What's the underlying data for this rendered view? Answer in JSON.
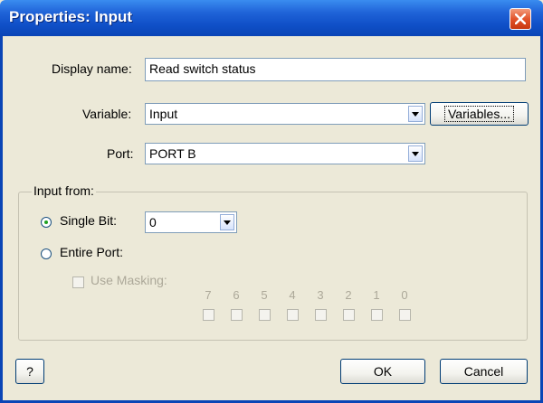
{
  "window": {
    "title": "Properties: Input"
  },
  "form": {
    "display_name_label": "Display name:",
    "display_name_value": "Read switch status",
    "variable_label": "Variable:",
    "variable_value": "Input",
    "variables_button": "Variables...",
    "port_label": "Port:",
    "port_value": "PORT B"
  },
  "input_from": {
    "legend": "Input from:",
    "single_bit_label": "Single Bit:",
    "single_bit_selected": true,
    "single_bit_value": "0",
    "entire_port_label": "Entire Port:",
    "entire_port_selected": false,
    "use_masking_label": "Use Masking:",
    "bits": [
      "7",
      "6",
      "5",
      "4",
      "3",
      "2",
      "1",
      "0"
    ]
  },
  "footer": {
    "help_label": "?",
    "ok_label": "OK",
    "cancel_label": "Cancel"
  },
  "colors": {
    "titlebar": "#0f4fc7",
    "close_button": "#e2532a",
    "dialog_bg": "#ece9d8",
    "radio_dot": "#21a121"
  }
}
